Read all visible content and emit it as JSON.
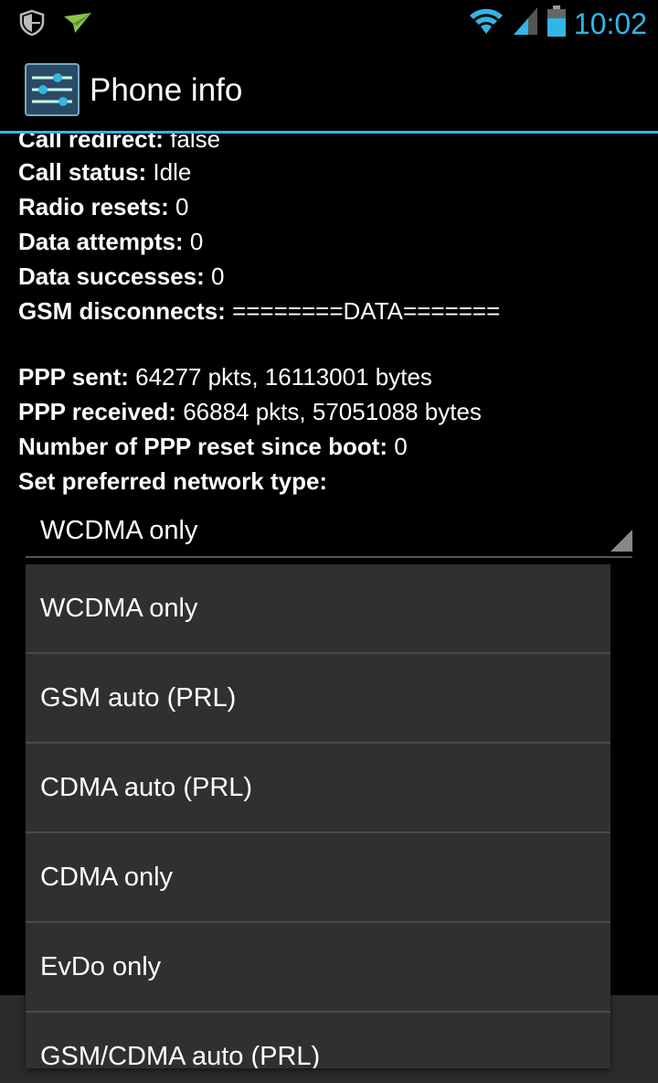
{
  "status_bar": {
    "time": "10:02",
    "icons": [
      "shield-icon",
      "paper-plane-icon",
      "wifi-icon",
      "cell-signal-icon",
      "battery-icon"
    ],
    "accent": "#33b5e5"
  },
  "action_bar": {
    "title": "Phone info",
    "icon": "settings-sliders-icon"
  },
  "info": [
    {
      "label": "Call redirect:",
      "value": "false"
    },
    {
      "label": "Call status:",
      "value": "Idle"
    },
    {
      "label": "Radio resets:",
      "value": "0"
    },
    {
      "label": "Data attempts:",
      "value": "0"
    },
    {
      "label": "Data successes:",
      "value": "0"
    },
    {
      "label": "GSM disconnects:",
      "value": "========DATA======="
    },
    {
      "label": "PPP sent:",
      "value": "64277 pkts, 16113001 bytes"
    },
    {
      "label": "PPP received:",
      "value": "66884 pkts, 57051088 bytes"
    },
    {
      "label": "Number of PPP reset since boot:",
      "value": "0"
    },
    {
      "label": "Set preferred network type:",
      "value": ""
    }
  ],
  "spinner": {
    "selected": "WCDMA only"
  },
  "dropdown": {
    "options": [
      "WCDMA only",
      "GSM auto (PRL)",
      "CDMA auto (PRL)",
      "CDMA only",
      "EvDo only",
      "GSM/CDMA auto (PRL)"
    ]
  }
}
